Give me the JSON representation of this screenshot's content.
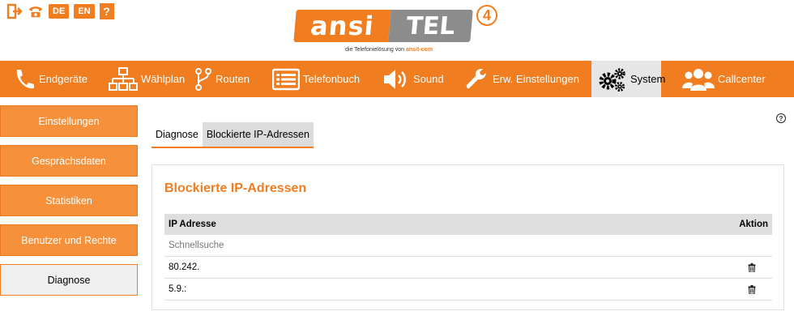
{
  "top_bar": {
    "lang_de": "DE",
    "lang_en": "EN",
    "help": "?"
  },
  "logo": {
    "ansi": "ansi",
    "tel": "TEL",
    "version": "4",
    "subtitle_prefix": "die Telefonielösung von ",
    "subtitle_brand": "ansit-com"
  },
  "nav": {
    "items": [
      {
        "label": "Endgeräte",
        "icon": "phone-icon"
      },
      {
        "label": "Wählplan",
        "icon": "sitemap-icon"
      },
      {
        "label": "Routen",
        "icon": "route-icon"
      },
      {
        "label": "Telefonbuch",
        "icon": "phonebook-icon"
      },
      {
        "label": "Sound",
        "icon": "speaker-icon"
      },
      {
        "label": "Erw. Einstellungen",
        "icon": "wrench-icon"
      },
      {
        "label": "System",
        "icon": "gears-icon"
      },
      {
        "label": "Callcenter",
        "icon": "users-icon"
      }
    ],
    "active": "System"
  },
  "sidebar": {
    "items": [
      {
        "label": "Einstellungen"
      },
      {
        "label": "Gesprächsdaten"
      },
      {
        "label": "Statistiken"
      },
      {
        "label": "Benutzer und Rechte"
      },
      {
        "label": "Diagnose"
      }
    ],
    "active": "Diagnose"
  },
  "tabs": [
    {
      "label": "Diagnose"
    },
    {
      "label": "Blockierte IP-Adressen"
    }
  ],
  "panel": {
    "title": "Blockierte IP-Adressen",
    "columns": {
      "ip": "IP Adresse",
      "action": "Aktion"
    },
    "search_placeholder": "Schnellsuche",
    "rows": [
      {
        "ip": "80.242."
      },
      {
        "ip": "5.9.:"
      }
    ]
  },
  "colors": {
    "accent": "#f07d1f",
    "logo_gray": "#8c8c8c"
  }
}
